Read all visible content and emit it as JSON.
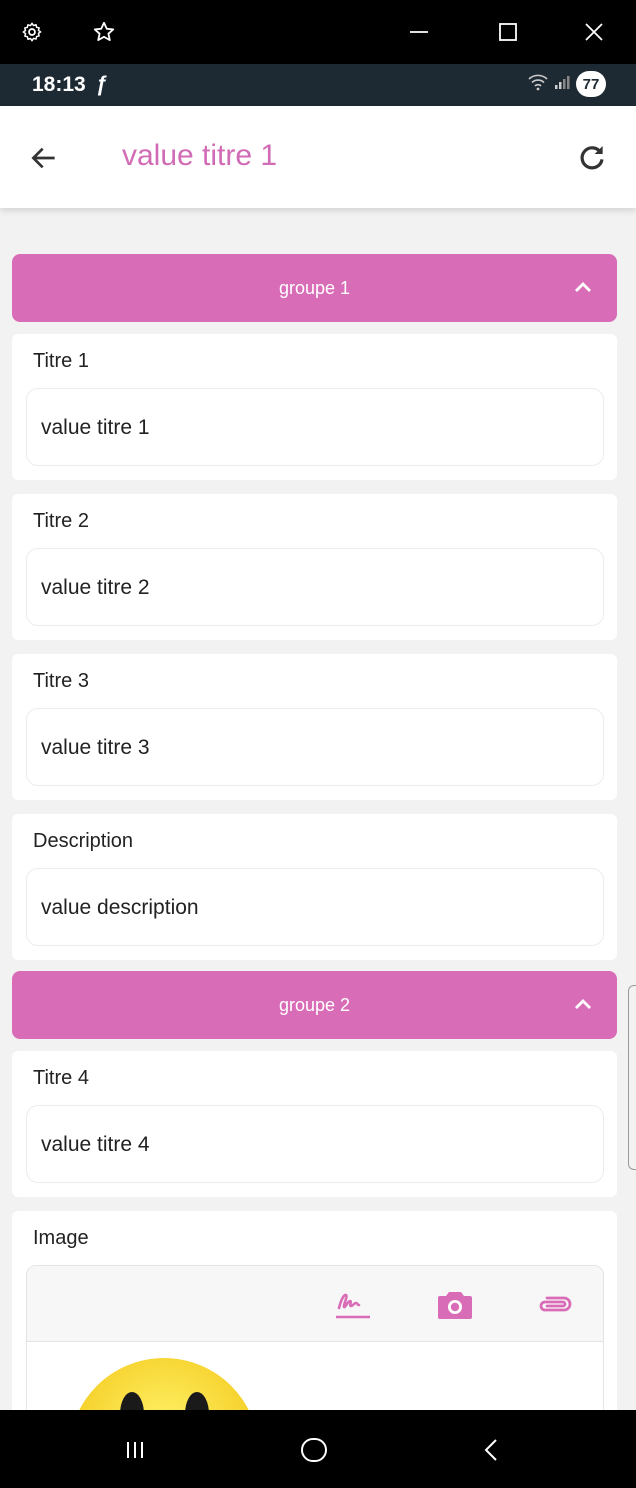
{
  "window": {
    "icons": [
      "gear-icon",
      "star-icon",
      "minimize-icon",
      "maximize-icon",
      "close-icon"
    ]
  },
  "status_bar": {
    "time": "18:13",
    "app_glyph": "ƒ",
    "battery": "77"
  },
  "header": {
    "title": "value titre 1",
    "back_icon": "arrow-left-icon",
    "refresh_icon": "refresh-icon"
  },
  "groups": [
    {
      "label": "groupe 1",
      "fields": [
        {
          "label": "Titre 1",
          "value": "value titre 1"
        },
        {
          "label": "Titre 2",
          "value": "value titre 2"
        },
        {
          "label": "Titre 3",
          "value": "value titre 3"
        },
        {
          "label": "Description",
          "value": "value description"
        }
      ]
    },
    {
      "label": "groupe 2",
      "fields": [
        {
          "label": "Titre 4",
          "value": "value titre 4"
        },
        {
          "label": "Image",
          "tools": [
            "signature-icon",
            "camera-icon",
            "paperclip-icon"
          ]
        }
      ]
    }
  ],
  "colors": {
    "accent": "#d96cb7",
    "title": "#d26bb5",
    "status_bar": "#1e2a33"
  },
  "nav_bar": {
    "icons": [
      "recent-apps-icon",
      "home-icon",
      "back-icon"
    ]
  }
}
